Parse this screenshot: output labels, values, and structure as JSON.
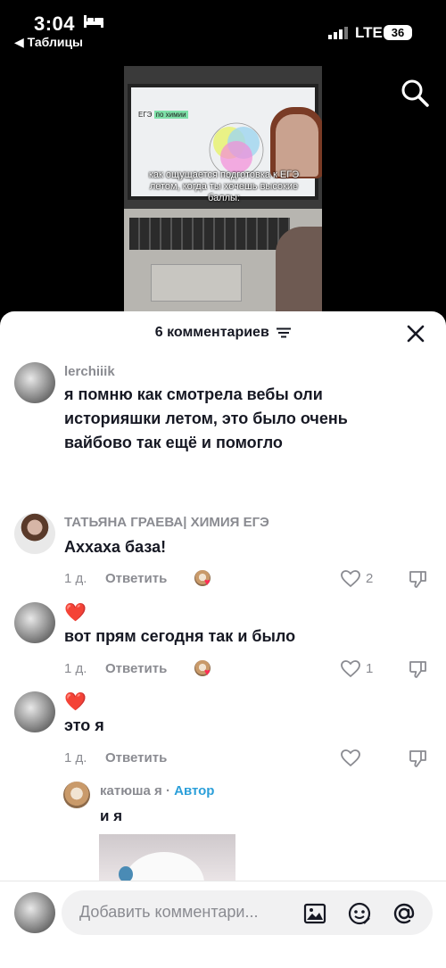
{
  "status_bar": {
    "time": "3:04",
    "back_label": "◀ Таблицы",
    "network": "LTE",
    "battery": "36"
  },
  "video": {
    "slide_title_a": "ЕГЭ",
    "slide_title_b": "по химии",
    "caption": "как ощущается подготовка к ЕГЭ летом, когда ты хочешь высокие баллы:"
  },
  "comments_header": {
    "count_label": "6 комментариев"
  },
  "comments": [
    {
      "username": "lerchiiik",
      "text": "я помню как смотрела вебы оли историяшки летом, это было очень вайбово так ещё и помогло"
    },
    {
      "username": "ТАТЬЯНА ГРАЕВА| ХИМИЯ ЕГЭ",
      "text": "Аххаха база!",
      "age": "1 д.",
      "reply_label": "Ответить",
      "likes": "2"
    },
    {
      "emoji": "❤️",
      "text": "вот прям сегодня так и было",
      "age": "1 д.",
      "reply_label": "Ответить",
      "likes": "1"
    },
    {
      "emoji": "❤️",
      "text": "это я",
      "age": "1 д.",
      "reply_label": "Ответить"
    }
  ],
  "reply": {
    "username": "катюша я",
    "separator": " · ",
    "author_tag": "Автор",
    "text": "и я"
  },
  "composer": {
    "placeholder": "Добавить комментари..."
  },
  "colors": {
    "accent_pink": "#fe2c55",
    "author_blue": "#2b9fd9",
    "muted": "#8a8b91"
  }
}
